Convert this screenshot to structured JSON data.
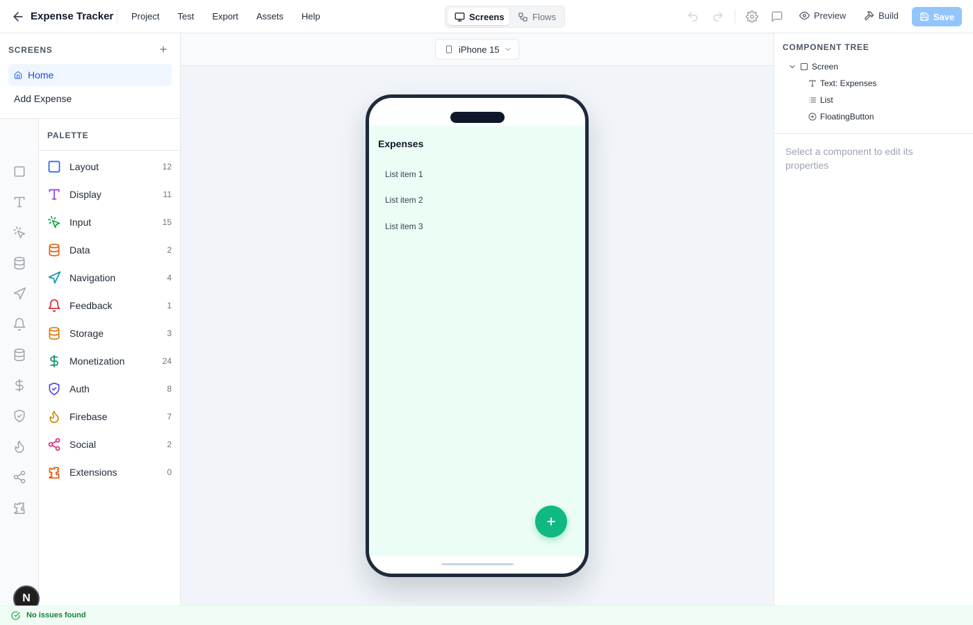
{
  "app": {
    "title": "Expense Tracker"
  },
  "menu": [
    "Project",
    "Test",
    "Export",
    "Assets",
    "Help"
  ],
  "view_toggle": {
    "screens": "Screens",
    "flows": "Flows",
    "active": "Screens"
  },
  "toolbar": {
    "preview_label": "Preview",
    "build_label": "Build",
    "save_label": "Save"
  },
  "screens_panel": {
    "heading": "SCREENS",
    "items": [
      {
        "label": "Home",
        "active": true
      },
      {
        "label": "Add Expense",
        "active": false
      }
    ]
  },
  "palette": {
    "heading": "PALETTE",
    "items": [
      {
        "label": "Layout",
        "count": "12",
        "icon": "square-icon",
        "color": "#2563eb"
      },
      {
        "label": "Display",
        "count": "11",
        "icon": "type-icon",
        "color": "#9333ea"
      },
      {
        "label": "Input",
        "count": "15",
        "icon": "pointer-click-icon",
        "color": "#16a34a"
      },
      {
        "label": "Data",
        "count": "2",
        "icon": "database-icon",
        "color": "#ea580c"
      },
      {
        "label": "Navigation",
        "count": "4",
        "icon": "navigation-icon",
        "color": "#0891b2"
      },
      {
        "label": "Feedback",
        "count": "1",
        "icon": "bell-icon",
        "color": "#dc2626"
      },
      {
        "label": "Storage",
        "count": "3",
        "icon": "database-icon",
        "color": "#d97706"
      },
      {
        "label": "Monetization",
        "count": "24",
        "icon": "dollar-icon",
        "color": "#059669"
      },
      {
        "label": "Auth",
        "count": "8",
        "icon": "shield-check-icon",
        "color": "#4f46e5"
      },
      {
        "label": "Firebase",
        "count": "7",
        "icon": "flame-icon",
        "color": "#ca8a04"
      },
      {
        "label": "Social",
        "count": "2",
        "icon": "share-icon",
        "color": "#db2777"
      },
      {
        "label": "Extensions",
        "count": "0",
        "icon": "puzzle-icon",
        "color": "#ea580c"
      }
    ]
  },
  "device": {
    "selected": "iPhone 15"
  },
  "phone_screen": {
    "title": "Expenses",
    "list_items": [
      "List item 1",
      "List item 2",
      "List item 3"
    ],
    "fab_label": "+"
  },
  "component_tree": {
    "heading": "COMPONENT TREE",
    "root": "Screen",
    "children": [
      "Text: Expenses",
      "List",
      "FloatingButton"
    ]
  },
  "properties": {
    "hint": "Select a component to edit its properties"
  },
  "user": {
    "initial": "N"
  },
  "status": {
    "text": "No issues found",
    "color": "#15803d"
  },
  "colors": {
    "accent": "#2563eb",
    "fab": "#10b981",
    "phone_bg": "#ecfdf5",
    "save_disabled": "#93c5fd"
  }
}
